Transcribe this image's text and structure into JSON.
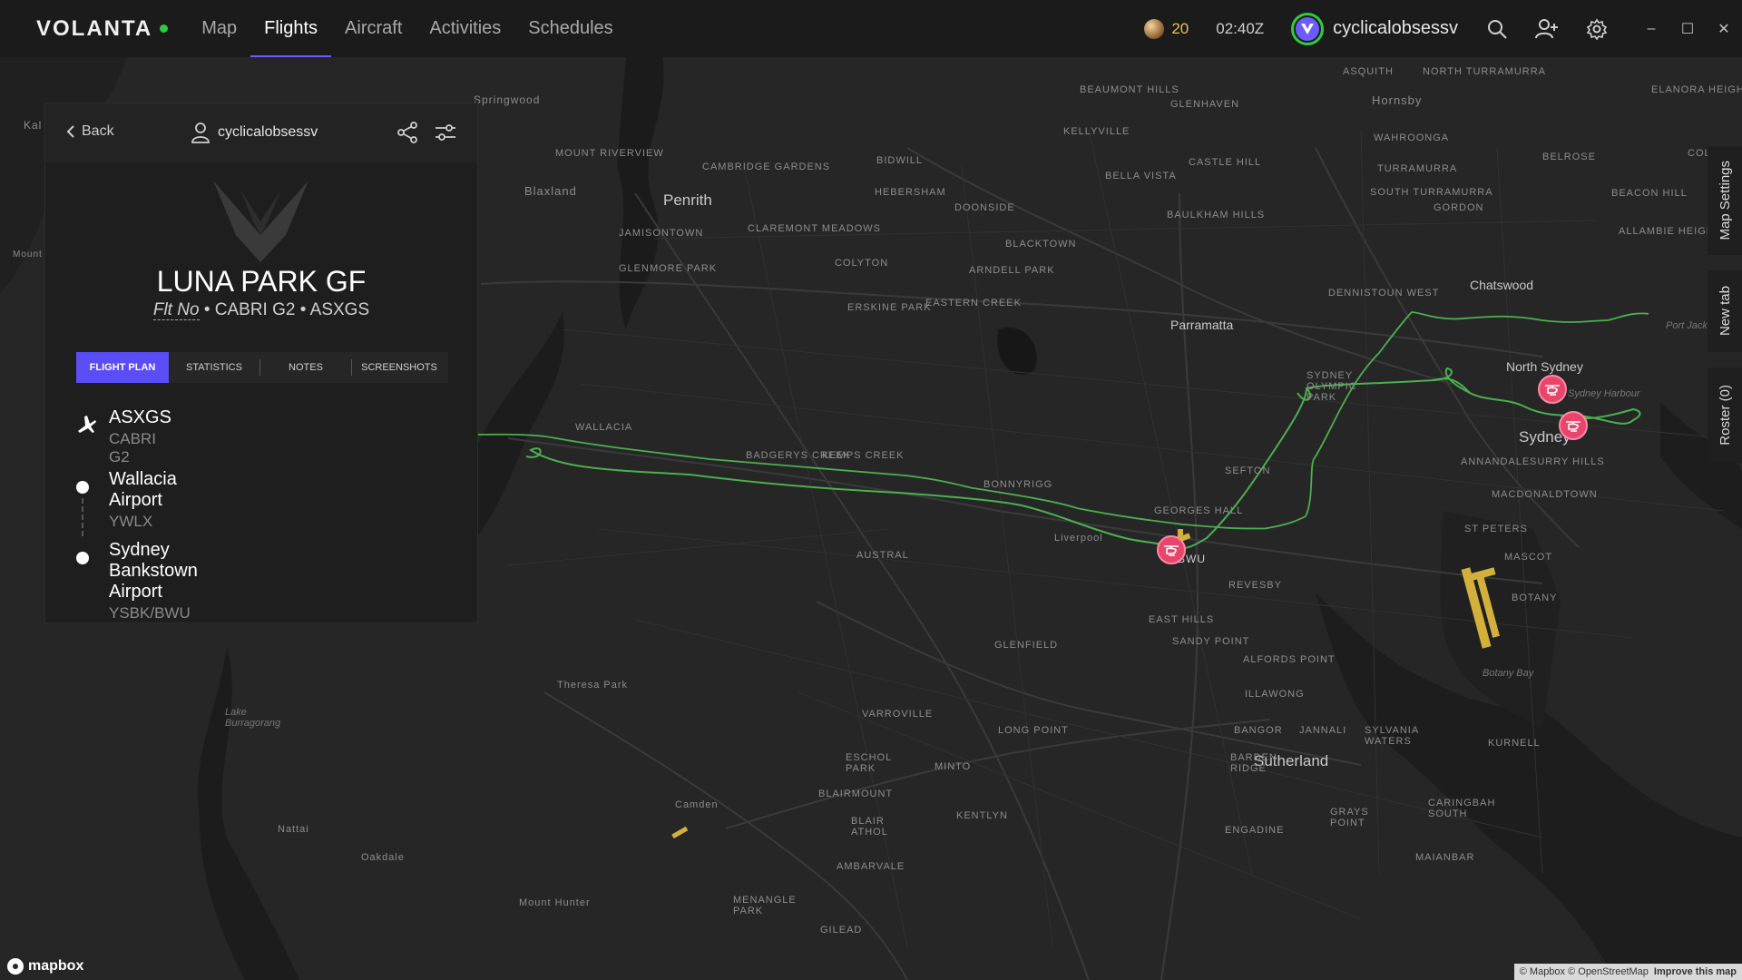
{
  "app": {
    "logo": "VOLANTA",
    "nav": [
      "Map",
      "Flights",
      "Aircraft",
      "Activities",
      "Schedules"
    ],
    "active_nav": "Flights",
    "coins": "20",
    "time": "02:40Z",
    "username": "cyclicalobsessv",
    "window_controls": {
      "minimize": "–",
      "maximize": "☐",
      "close": "✕"
    }
  },
  "panel": {
    "back_label": "Back",
    "username": "cyclicalobsessv",
    "title": "LUNA PARK GF",
    "subtitle": {
      "flt_no": "Flt No",
      "aircraft": "CABRI G2",
      "registration": "ASXGS"
    },
    "tabs": [
      "FLIGHT PLAN",
      "STATISTICS",
      "NOTES",
      "SCREENSHOTS"
    ],
    "active_tab": "FLIGHT PLAN",
    "route": [
      {
        "icon": "plane-icon",
        "title": "ASXGS",
        "sub": "CABRI G2"
      },
      {
        "icon": "dot-icon",
        "title": "Wallacia Airport",
        "sub": "YWLX"
      },
      {
        "icon": "dot-icon",
        "title": "Sydney Bankstown Airport",
        "sub": "YSBK/BWU"
      }
    ]
  },
  "side_tabs": [
    "Map Settings",
    "New tab",
    "Roster (0)"
  ],
  "map": {
    "labels_major": [
      "Penrith",
      "Parramatta",
      "Chatswood",
      "North Sydney",
      "Sydney",
      "Sutherland"
    ],
    "labels_minor": [
      "Hornsby",
      "Blaxland",
      "Springwood",
      "Kal",
      "Mount",
      "Mount Riverview",
      "Cambridge Gardens",
      "Jamisontown",
      "Claremont Meadows",
      "Glenmore Park",
      "Colyton",
      "Erskine Park",
      "Eastern Creek",
      "Arndell Park",
      "Blacktown",
      "Doonside",
      "Bidwill",
      "Hebersham",
      "Baulkham Hills",
      "Bella Vista",
      "Castle Hill",
      "Kellyville",
      "Beaumont Hills",
      "Glenhaven",
      "Asquith",
      "North Turramurra",
      "Wahroonga",
      "Turramurra",
      "South Turramurra",
      "Gordon",
      "Belrose",
      "Elanora Heights",
      "Collaroy Plateau",
      "Beacon Hill",
      "Allambie Heights",
      "Dennistoun West",
      "Sydney Olympic Park",
      "Wallacia",
      "Badgerys Creek",
      "Kemps Creek",
      "Bonnyrigg",
      "Sefton",
      "Georges Hall",
      "Liverpool",
      "Austral",
      "Revesby",
      "East Hills",
      "Sandy Point",
      "Alfords Point",
      "Glenfield",
      "Theresa Park",
      "Annandale",
      "Surry Hills",
      "Macdonaldtown",
      "St Peters",
      "Mascot",
      "Botany",
      "Illawong",
      "Bangor",
      "Jannali",
      "Sylvania Waters",
      "Kurnell",
      "Varroville",
      "Long Point",
      "Eschol Park",
      "Minto",
      "Barden Ridge",
      "Blairmount",
      "Blair Athol",
      "Kentlyn",
      "Ambarvale",
      "Engadine",
      "Grays Point",
      "Caringbah South",
      "Maianbar",
      "Camden",
      "Nattai",
      "Oakdale",
      "Mount Hunter",
      "Menangle Park",
      "Gilead",
      "Lake Burragorang"
    ],
    "labels_water": [
      "Sydney Harbour",
      "Port Jackson",
      "Botany Bay"
    ],
    "airport_code": "BWU",
    "attribution": "© Mapbox © OpenStreetMap",
    "improve": "Improve this map",
    "mapbox_logo": "mapbox"
  }
}
